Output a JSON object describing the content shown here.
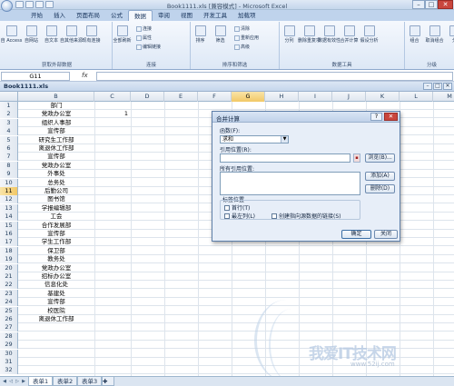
{
  "window": {
    "title": "Book1111.xls [兼容模式] - Microsoft Excel",
    "controls": {
      "minimize": "–",
      "maximize": "□",
      "close": "✕"
    }
  },
  "ribbon_tabs": [
    "开始",
    "插入",
    "页面布局",
    "公式",
    "数据",
    "审阅",
    "视图",
    "开发工具",
    "加载项"
  ],
  "active_tab": "数据",
  "ribbon": {
    "groups": [
      {
        "label": "获取外部数据",
        "buttons": [
          "自 Access",
          "自网站",
          "自文本",
          "自其他来源",
          "现有连接"
        ]
      },
      {
        "label": "连接",
        "buttons": [
          "全部刷新"
        ],
        "small": [
          "连接",
          "属性",
          "编辑链接"
        ]
      },
      {
        "label": "排序和筛选",
        "buttons": [
          "排序",
          "筛选"
        ],
        "small": [
          "清除",
          "重新应用",
          "高级"
        ]
      },
      {
        "label": "数据工具",
        "buttons": [
          "分列",
          "删除重复项",
          "数据有效性",
          "合并计算",
          "假设分析"
        ]
      },
      {
        "label": "分级",
        "buttons": [
          "组合",
          "取消组合",
          "分"
        ]
      }
    ]
  },
  "formula_bar": {
    "name_box": "G11",
    "fx": "fx",
    "formula": ""
  },
  "workbook": {
    "title": "Book1111.xls"
  },
  "grid": {
    "columns": [
      "B",
      "C",
      "D",
      "E",
      "F",
      "G",
      "H",
      "I",
      "J",
      "K",
      "L",
      "M"
    ],
    "selected_column": "G",
    "selected_row": "11",
    "rows": [
      {
        "num": "1",
        "b": "部门",
        "c": ""
      },
      {
        "num": "2",
        "b": "党政办公室",
        "c": "1"
      },
      {
        "num": "3",
        "b": "组织人事部",
        "c": ""
      },
      {
        "num": "4",
        "b": "宣传部",
        "c": ""
      },
      {
        "num": "5",
        "b": "研究生工作部",
        "c": ""
      },
      {
        "num": "6",
        "b": "离退休工作部",
        "c": ""
      },
      {
        "num": "7",
        "b": "宣传部",
        "c": ""
      },
      {
        "num": "8",
        "b": "党政办公室",
        "c": ""
      },
      {
        "num": "9",
        "b": "外事处",
        "c": ""
      },
      {
        "num": "10",
        "b": "总务处",
        "c": ""
      },
      {
        "num": "11",
        "b": "后勤公司",
        "c": ""
      },
      {
        "num": "12",
        "b": "图书馆",
        "c": ""
      },
      {
        "num": "13",
        "b": "学报编辑部",
        "c": ""
      },
      {
        "num": "14",
        "b": "工会",
        "c": ""
      },
      {
        "num": "15",
        "b": "合作发展部",
        "c": ""
      },
      {
        "num": "16",
        "b": "宣传部",
        "c": ""
      },
      {
        "num": "17",
        "b": "学生工作部",
        "c": ""
      },
      {
        "num": "18",
        "b": "保卫部",
        "c": ""
      },
      {
        "num": "19",
        "b": "教务处",
        "c": ""
      },
      {
        "num": "20",
        "b": "党政办公室",
        "c": ""
      },
      {
        "num": "21",
        "b": "招标办公室",
        "c": ""
      },
      {
        "num": "22",
        "b": "信息化处",
        "c": ""
      },
      {
        "num": "23",
        "b": "基建处",
        "c": ""
      },
      {
        "num": "24",
        "b": "宣传部",
        "c": ""
      },
      {
        "num": "25",
        "b": "校医院",
        "c": ""
      },
      {
        "num": "26",
        "b": "离退休工作部",
        "c": ""
      },
      {
        "num": "27",
        "b": "",
        "c": ""
      },
      {
        "num": "28",
        "b": "",
        "c": ""
      },
      {
        "num": "29",
        "b": "",
        "c": ""
      },
      {
        "num": "30",
        "b": "",
        "c": ""
      },
      {
        "num": "31",
        "b": "",
        "c": ""
      },
      {
        "num": "32",
        "b": "",
        "c": ""
      }
    ]
  },
  "dialog": {
    "title": "合并计算",
    "help": "?",
    "close": "✕",
    "function_label": "函数(F):",
    "function_value": "求和",
    "reference_label": "引用位置(R):",
    "browse_button": "浏览(B)...",
    "all_references_label": "所有引用位置:",
    "add_button": "添加(A)",
    "delete_button": "删除(D)",
    "label_position": "标签位置",
    "top_row": "首行(T)",
    "left_column": "最左列(L)",
    "create_links": "创建指向源数据的链接(S)",
    "ok_button": "确定",
    "close_button": "关闭"
  },
  "sheet_tabs": [
    "表单1",
    "表单2",
    "表单3"
  ],
  "active_sheet": "表单1",
  "watermark": {
    "text": "我爱IT技术网",
    "url": "www.52ij.com"
  }
}
